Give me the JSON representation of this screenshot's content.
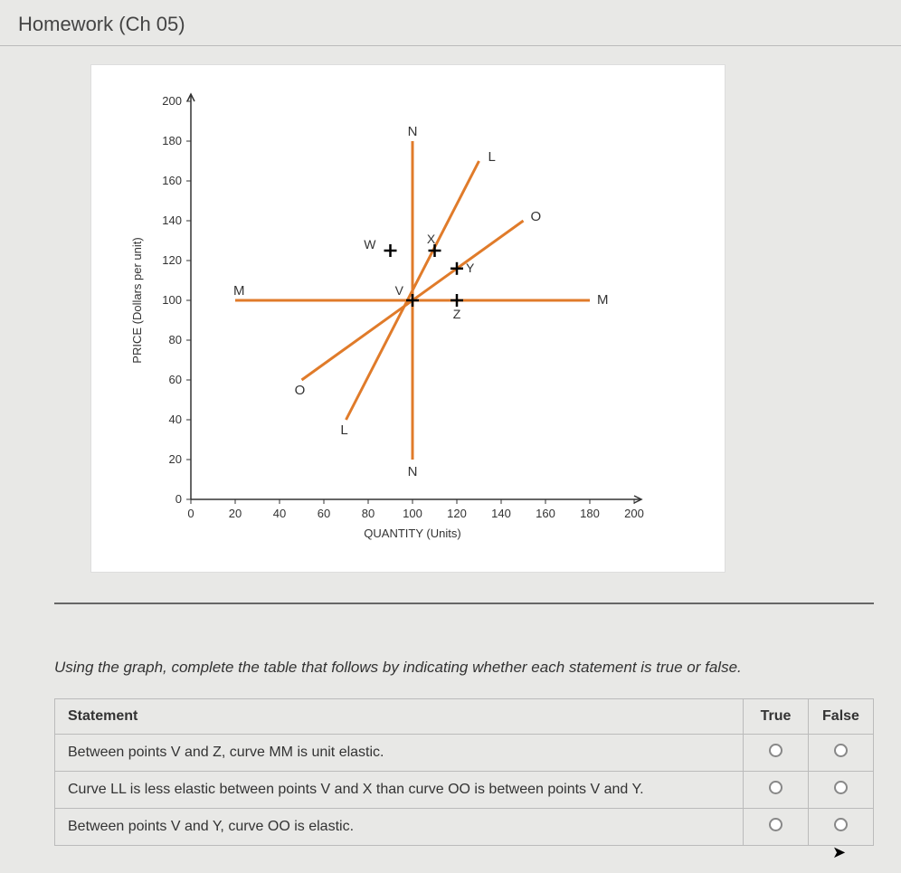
{
  "page": {
    "title": "Homework (Ch 05)"
  },
  "chart_data": {
    "type": "line",
    "xlabel": "QUANTITY (Units)",
    "ylabel": "PRICE (Dollars per unit)",
    "x_ticks": [
      0,
      20,
      40,
      60,
      80,
      100,
      120,
      140,
      160,
      180,
      200
    ],
    "y_ticks": [
      0,
      20,
      40,
      60,
      80,
      100,
      120,
      140,
      160,
      180,
      200
    ],
    "xlim": [
      0,
      200
    ],
    "ylim": [
      0,
      200
    ],
    "curves": [
      {
        "name": "M",
        "label_start": "M",
        "label_end": "M",
        "endpoints": [
          [
            20,
            100
          ],
          [
            180,
            100
          ]
        ]
      },
      {
        "name": "N",
        "label_start": "N",
        "label_end": "N",
        "endpoints": [
          [
            100,
            20
          ],
          [
            100,
            180
          ]
        ]
      },
      {
        "name": "L",
        "label_start": "L",
        "label_end": "L",
        "endpoints": [
          [
            70,
            40
          ],
          [
            130,
            170
          ]
        ]
      },
      {
        "name": "O",
        "label_start": "O",
        "label_end": "O",
        "endpoints": [
          [
            50,
            60
          ],
          [
            150,
            140
          ]
        ]
      }
    ],
    "points": [
      {
        "name": "W",
        "x": 90,
        "y": 125
      },
      {
        "name": "X",
        "x": 110,
        "y": 125
      },
      {
        "name": "Y",
        "x": 120,
        "y": 116
      },
      {
        "name": "Z",
        "x": 120,
        "y": 100
      },
      {
        "name": "V",
        "x": 100,
        "y": 100
      }
    ]
  },
  "instructions": "Using the graph, complete the table that follows by indicating whether each statement is true or false.",
  "table": {
    "header_statement": "Statement",
    "header_true": "True",
    "header_false": "False",
    "rows": [
      {
        "text": "Between points V and Z, curve MM is unit elastic."
      },
      {
        "text": "Curve LL is less elastic between points V and X than curve OO is between points V and Y."
      },
      {
        "text": "Between points V and Y, curve OO is elastic."
      }
    ]
  }
}
